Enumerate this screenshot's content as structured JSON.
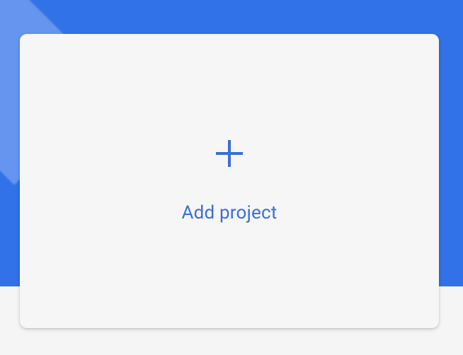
{
  "card": {
    "add_project_label": "Add project"
  },
  "colors": {
    "banner": "#3172e8",
    "card_bg": "#f6f6f6",
    "accent": "#3a6ed8"
  }
}
